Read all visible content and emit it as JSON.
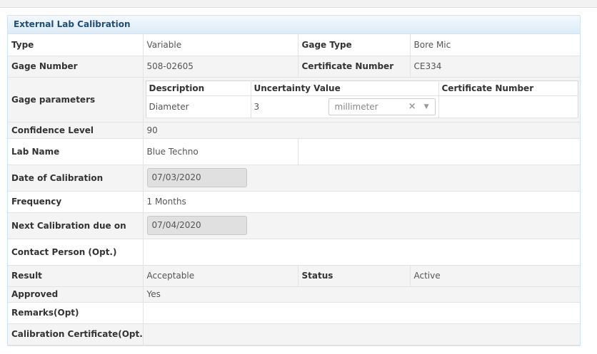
{
  "panel": {
    "title": "External Lab Calibration"
  },
  "rows": {
    "type": {
      "label": "Type",
      "value": "Variable",
      "label2": "Gage Type",
      "value2": "Bore Mic"
    },
    "gage_number": {
      "label": "Gage Number",
      "value": "508-02605",
      "label2": "Certificate Number",
      "value2": "CE334"
    },
    "gage_parameters": {
      "label": "Gage parameters",
      "headers": {
        "description": "Description",
        "uncertainty": "Uncertainty Value",
        "certificate": "Certificate Number"
      },
      "row": {
        "description": "Diameter",
        "uncertainty": "3",
        "unit": "millimeter",
        "certificate": ""
      }
    },
    "confidence": {
      "label": "Confidence Level",
      "value": "90"
    },
    "lab_name": {
      "label": "Lab Name",
      "value": "Blue Techno"
    },
    "date_of_calibration": {
      "label": "Date of Calibration",
      "value": "07/03/2020"
    },
    "frequency": {
      "label": "Frequency",
      "value": "1 Months"
    },
    "next_due": {
      "label": "Next Calibration due on",
      "value": "07/04/2020"
    },
    "contact_person": {
      "label": "Contact Person (Opt.)",
      "value": ""
    },
    "result": {
      "label": "Result",
      "value": "Acceptable",
      "label2": "Status",
      "value2": "Active"
    },
    "approved": {
      "label": "Approved",
      "value": "Yes"
    },
    "remarks": {
      "label": "Remarks(Opt)",
      "value": ""
    },
    "certificate_file": {
      "label": "Calibration Certificate(Opt.)",
      "value": ""
    }
  },
  "icons": {
    "clear": "close-icon",
    "dropdown": "chevron-down-icon"
  },
  "colors": {
    "header_text": "#1f4e79",
    "header_bg": "#dcecf8",
    "border": "#cfe3f2"
  }
}
